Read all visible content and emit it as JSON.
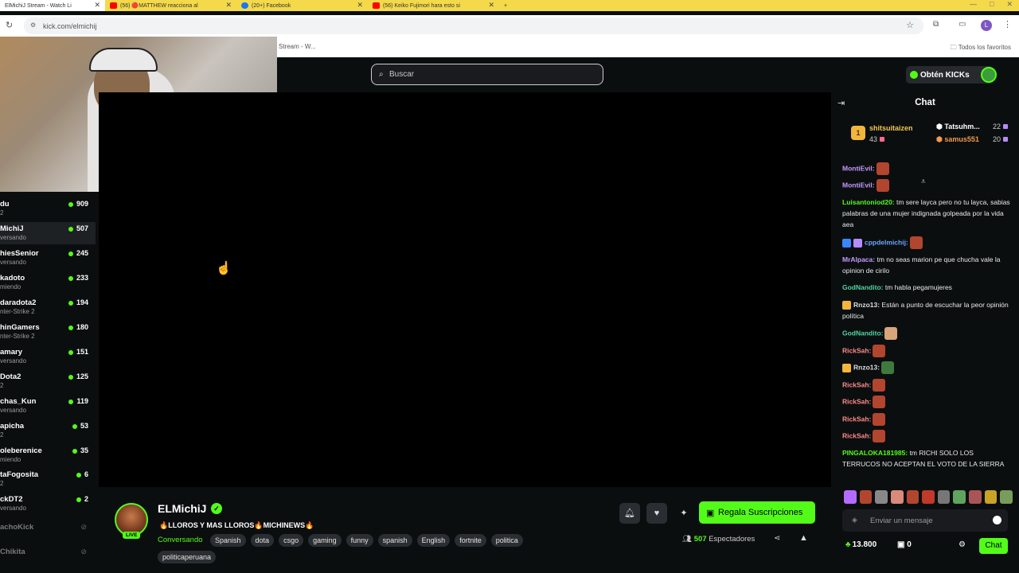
{
  "browser": {
    "tabs": [
      {
        "label": "ElMichiJ Stream - Watch Li",
        "active": true,
        "color": "#ffffff"
      },
      {
        "label": "(56) 🔴MATTHEW reacciona al",
        "active": false,
        "color": "#ff0000"
      },
      {
        "label": "(20+) Facebook",
        "active": false,
        "color": "#1877f2"
      },
      {
        "label": "(56) Keiko Fujimori hara esto si",
        "active": false,
        "color": "#ff0000"
      }
    ],
    "new_tab": "+",
    "url": "kick.com/elmichij",
    "bookmark_left": "Stream - W...",
    "bookmark_right": "Todos los favoritos"
  },
  "header": {
    "search_placeholder": "Buscar",
    "kicks_label": "Obtén KICKs"
  },
  "sidebar": {
    "channels": [
      {
        "name": "du",
        "cat": "2",
        "count": "909"
      },
      {
        "name": "MichiJ",
        "cat": "versando",
        "count": "507",
        "active": true
      },
      {
        "name": "hiesSenior",
        "cat": "versando",
        "count": "245"
      },
      {
        "name": "kadoto",
        "cat": "miendo",
        "count": "233"
      },
      {
        "name": "daradota2",
        "cat": "nter-Strike 2",
        "count": "194"
      },
      {
        "name": "hinGamers",
        "cat": "nter-Strike 2",
        "count": "180"
      },
      {
        "name": "amary",
        "cat": "versando",
        "count": "151"
      },
      {
        "name": "Dota2",
        "cat": "2",
        "count": "125"
      },
      {
        "name": "chas_Kun",
        "cat": "versando",
        "count": "119"
      },
      {
        "name": "apicha",
        "cat": "2",
        "count": "53"
      },
      {
        "name": "oleberenice",
        "cat": "miendo",
        "count": "35"
      },
      {
        "name": "taFogosita",
        "cat": "2",
        "count": "6"
      },
      {
        "name": "ckDT2",
        "cat": "versando",
        "count": "2"
      }
    ],
    "offline": [
      "achoKick",
      "Chikita"
    ]
  },
  "stream": {
    "channel_name": "ELMichiJ",
    "live_label": "LIVE",
    "title": "🔥LLOROS Y MAS LLOROS🔥MICHINEWS🔥",
    "category": "Conversando",
    "tags": [
      "Spanish",
      "dota",
      "csgo",
      "gaming",
      "funny",
      "spanish",
      "English",
      "fortnite",
      "politica"
    ],
    "tag_extra": "politicaperuana",
    "gift_label": "Regala Suscripciones",
    "viewers_count": "507",
    "viewers_label": "Espectadores"
  },
  "chat": {
    "title": "Chat",
    "leaders": [
      {
        "rank": "1",
        "name": "shitsuitaizen",
        "value": "43"
      },
      {
        "name": "Tatsuhm...",
        "value": "22"
      },
      {
        "name": "samus551",
        "value": "20"
      }
    ],
    "messages": [
      {
        "user": "MontiEvil:",
        "text": "",
        "color": "#c89bff",
        "emote": true
      },
      {
        "user": "MontiEvil:",
        "text": "",
        "color": "#c89bff",
        "emote": true
      },
      {
        "user": "Luisantoniod20:",
        "text": " tm sere layca pero no tu layca, sabias palabras de una mujer indignada golpeada por la vida aea",
        "color": "#53fc18"
      },
      {
        "user": "cppdelmichij:",
        "text": "",
        "color": "#6aa8ff",
        "emote": true,
        "badges": true
      },
      {
        "user": "MrAlpaca:",
        "text": " tm no seas marion pe que chucha vale la opinion de cirilo",
        "color": "#c89bff"
      },
      {
        "user": "GodNandito:",
        "text": " tm habla pegamujeres",
        "color": "#53d4a0"
      },
      {
        "user": "Rnzo13:",
        "text": " Están a punto de escuchar la peor opinión política",
        "color": "#dddddd",
        "crown": true
      },
      {
        "user": "GodNandito:",
        "text": "",
        "color": "#53d4a0",
        "emote": true
      },
      {
        "user": "RickSah:",
        "text": "",
        "color": "#ff8a8a",
        "emote": true
      },
      {
        "user": "Rnzo13:",
        "text": "",
        "color": "#dddddd",
        "emote": true,
        "crown": true
      },
      {
        "user": "RickSah:",
        "text": "",
        "color": "#ff8a8a",
        "emote": true
      },
      {
        "user": "RickSah:",
        "text": "",
        "color": "#ff8a8a",
        "emote": true
      },
      {
        "user": "RickSah:",
        "text": "",
        "color": "#ff8a8a",
        "emote": true
      },
      {
        "user": "RickSah:",
        "text": "",
        "color": "#ff8a8a",
        "emote": true
      },
      {
        "user": "PINGALOKA181985:",
        "text": " tm RICHI SOLO LOS TERRUCOS NO ACEPTAN EL VOTO DE LA SIERRA",
        "color": "#53fc18"
      }
    ],
    "input_placeholder": "Enviar un mensaje",
    "points": "13.800",
    "chest_count": "0",
    "send_label": "Chat"
  }
}
